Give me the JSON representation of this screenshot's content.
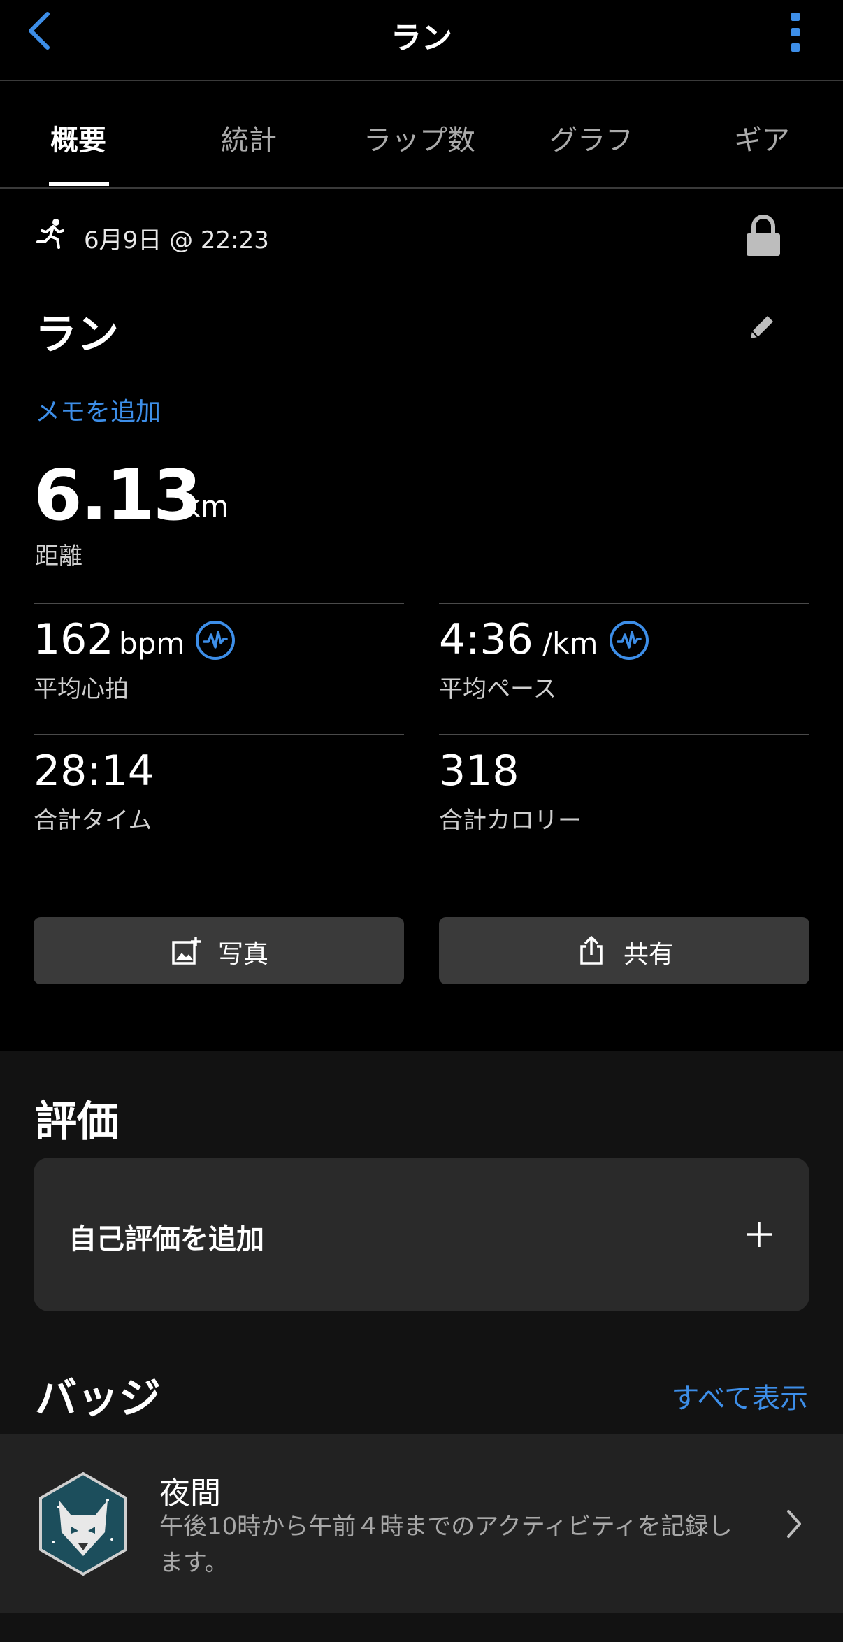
{
  "header": {
    "title": "ラン"
  },
  "tabs": [
    {
      "label": "概要"
    },
    {
      "label": "統計"
    },
    {
      "label": "ラップ数"
    },
    {
      "label": "グラフ"
    },
    {
      "label": "ギア"
    }
  ],
  "activity": {
    "datetime": "6月9日 @ 22:23",
    "name": "ラン",
    "add_memo": "メモを追加",
    "distance": {
      "value": "6.13",
      "unit": "km",
      "label": "距離"
    },
    "stats": [
      {
        "value": "162",
        "unit": "bpm",
        "label": "平均心拍"
      },
      {
        "value": "4:36",
        "unit": "/km",
        "label": "平均ペース"
      },
      {
        "value": "28:14",
        "unit": "",
        "label": "合計タイム"
      },
      {
        "value": "318",
        "unit": "",
        "label": "合計カロリー"
      }
    ]
  },
  "buttons": {
    "photo": "写真",
    "share": "共有"
  },
  "evaluation": {
    "title": "評価",
    "add_label": "自己評価を追加"
  },
  "badges": {
    "title": "バッジ",
    "see_all": "すべて表示",
    "item": {
      "name": "夜間",
      "description": "午後10時から午前４時までのアクティビティを記録します。"
    }
  },
  "colors": {
    "accent": "#3d8ee8",
    "background": "#000000",
    "card": "#2a2a2a",
    "button": "#3a3a3a"
  }
}
